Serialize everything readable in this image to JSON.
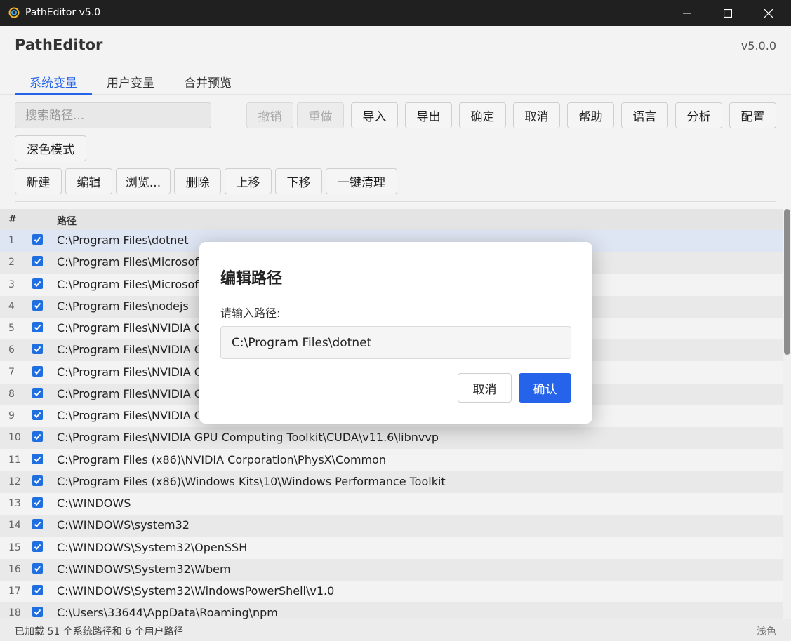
{
  "window": {
    "title": "PathEditor v5.0",
    "icon": "patheditor-app-icon"
  },
  "header": {
    "app_name": "PathEditor",
    "version": "v5.0.0"
  },
  "tabs": [
    {
      "label": "系统变量",
      "active": true
    },
    {
      "label": "用户变量",
      "active": false
    },
    {
      "label": "合并预览",
      "active": false
    }
  ],
  "search": {
    "placeholder": "搜索路径...",
    "value": ""
  },
  "toolbar": {
    "undo": "撤销",
    "redo": "重做",
    "import": "导入",
    "export": "导出",
    "confirm": "确定",
    "cancel": "取消",
    "help": "帮助",
    "language": "语言",
    "analyze": "分析",
    "config": "配置",
    "dark_mode": "深色模式"
  },
  "actions": {
    "new": "新建",
    "edit": "编辑",
    "browse": "浏览...",
    "delete": "删除",
    "move_up": "上移",
    "move_down": "下移",
    "clean": "一键清理"
  },
  "table": {
    "col_num": "#",
    "col_path": "路径",
    "rows": [
      {
        "num": "1",
        "path": "C:\\Program Files\\dotnet",
        "checked": true,
        "selected": true
      },
      {
        "num": "2",
        "path": "C:\\Program Files\\Microsoft",
        "checked": true
      },
      {
        "num": "3",
        "path": "C:\\Program Files\\Microsoft",
        "checked": true
      },
      {
        "num": "4",
        "path": "C:\\Program Files\\nodejs",
        "checked": true
      },
      {
        "num": "5",
        "path": "C:\\Program Files\\NVIDIA C",
        "checked": true
      },
      {
        "num": "6",
        "path": "C:\\Program Files\\NVIDIA C",
        "checked": true
      },
      {
        "num": "7",
        "path": "C:\\Program Files\\NVIDIA G",
        "checked": true
      },
      {
        "num": "8",
        "path": "C:\\Program Files\\NVIDIA G",
        "checked": true
      },
      {
        "num": "9",
        "path": "C:\\Program Files\\NVIDIA G",
        "checked": true
      },
      {
        "num": "10",
        "path": "C:\\Program Files\\NVIDIA GPU Computing Toolkit\\CUDA\\v11.6\\libnvvp",
        "checked": true
      },
      {
        "num": "11",
        "path": "C:\\Program Files (x86)\\NVIDIA Corporation\\PhysX\\Common",
        "checked": true
      },
      {
        "num": "12",
        "path": "C:\\Program Files (x86)\\Windows Kits\\10\\Windows Performance Toolkit",
        "checked": true
      },
      {
        "num": "13",
        "path": "C:\\WINDOWS",
        "checked": true
      },
      {
        "num": "14",
        "path": "C:\\WINDOWS\\system32",
        "checked": true
      },
      {
        "num": "15",
        "path": "C:\\WINDOWS\\System32\\OpenSSH",
        "checked": true
      },
      {
        "num": "16",
        "path": "C:\\WINDOWS\\System32\\Wbem",
        "checked": true
      },
      {
        "num": "17",
        "path": "C:\\WINDOWS\\System32\\WindowsPowerShell\\v1.0",
        "checked": true
      },
      {
        "num": "18",
        "path": "C:\\Users\\33644\\AppData\\Roaming\\npm",
        "checked": true
      }
    ]
  },
  "status": {
    "text": "已加载 51 个系统路径和 6 个用户路径",
    "theme": "浅色"
  },
  "dialog": {
    "title": "编辑路径",
    "label": "请输入路径:",
    "value": "C:\\Program Files\\dotnet",
    "cancel": "取消",
    "ok": "确认"
  },
  "colors": {
    "accent": "#2563eb",
    "titlebar": "#202020",
    "checkbox": "#1f6fe0"
  }
}
